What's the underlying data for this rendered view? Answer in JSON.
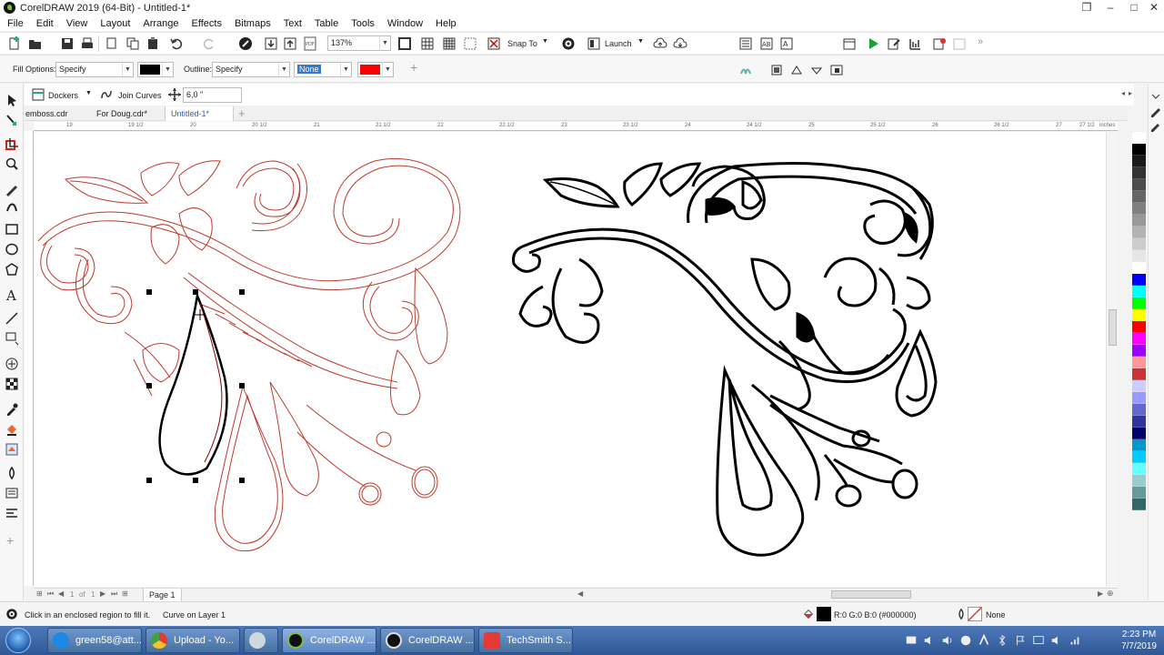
{
  "window": {
    "title": "CorelDRAW 2019 (64-Bit) - Untitled-1*",
    "controls": [
      "❐",
      "–",
      "□",
      "✕"
    ]
  },
  "menu": [
    "File",
    "Edit",
    "View",
    "Layout",
    "Arrange",
    "Effects",
    "Bitmaps",
    "Text",
    "Table",
    "Tools",
    "Window",
    "Help"
  ],
  "standard_toolbar": {
    "zoom": "137%",
    "snap_to": "Snap To",
    "launch": "Launch"
  },
  "property_bar": {
    "fill_options_label": "Fill Options:",
    "fill_mode": "Specify",
    "fill_color": "#000000",
    "outline_label": "Outline:",
    "outline_mode": "Specify",
    "outline_width": "None",
    "outline_color": "#ff0000"
  },
  "docker_bar": {
    "dockers": "Dockers",
    "join_curves": "Join Curves",
    "distance": "6,0 \""
  },
  "tabs": [
    {
      "label": "emboss.cdr",
      "active": false
    },
    {
      "label": "For Doug.cdr*",
      "active": false
    },
    {
      "label": "Untitled-1*",
      "active": true
    }
  ],
  "ruler": {
    "labels": [
      "19",
      "19 1/2",
      "20",
      "20 1/2",
      "21",
      "21 1/2",
      "22",
      "22 1/2",
      "23",
      "23 1/2",
      "24",
      "24 1/2",
      "25",
      "25 1/2",
      "26",
      "26 1/2",
      "27",
      "27 1/2",
      "inches"
    ]
  },
  "page_nav": {
    "current": "1",
    "of": "of",
    "total": "1",
    "page_tab": "Page 1"
  },
  "status": {
    "hint": "Click in an enclosed region to fill it.",
    "object": "Curve on Layer 1",
    "fill_info": "R:0 G:0 B:0 (#000000)",
    "outline_info": "None"
  },
  "palette": [
    "#ffffff",
    "#000000",
    "#1a1a1a",
    "#333333",
    "#4d4d4d",
    "#666666",
    "#808080",
    "#999999",
    "#b3b3b3",
    "#cccccc",
    "#e6e6e6",
    "#ffffff",
    "#0000ff",
    "#00ffff",
    "#00ff00",
    "#ffff00",
    "#ff0000",
    "#ff00ff",
    "#9900ff",
    "#ff9999",
    "#cc3333",
    "#ccccff",
    "#9999ff",
    "#6666cc",
    "#333399",
    "#000066",
    "#0099cc",
    "#00ccff",
    "#66ffff",
    "#99cccc",
    "#669999",
    "#336666"
  ],
  "taskbar": {
    "buttons": [
      {
        "label": "green58@att...",
        "icon_color": "#1e88e5"
      },
      {
        "label": "Upload - Yo...",
        "icon_color": "#e53935"
      },
      {
        "label": "",
        "icon_color": "#cfd8dc"
      },
      {
        "label": "CorelDRAW ...",
        "icon_color": "#111111"
      },
      {
        "label": "CorelDRAW ...",
        "icon_color": "#111111"
      },
      {
        "label": "TechSmith S...",
        "icon_color": "#e53935"
      }
    ],
    "time": "2:23 PM",
    "date": "7/7/2019"
  }
}
